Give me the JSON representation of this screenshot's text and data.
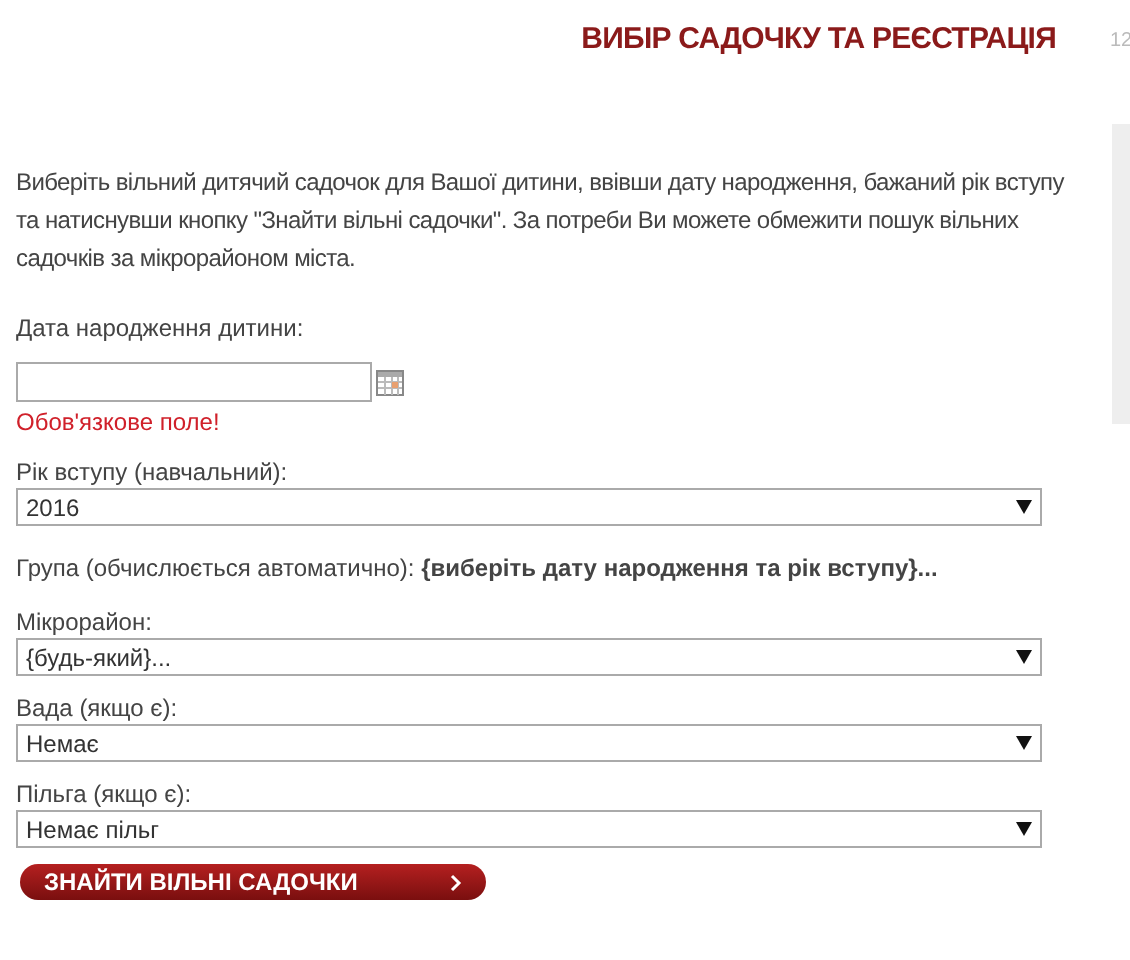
{
  "header": {
    "title": "ВИБІР САДОЧКУ ТА РЕЄСТРАЦІЯ",
    "side_text": "12"
  },
  "intro": "Виберіть вільний дитячий садочок для Вашої дитини, ввівши дату народження, бажаний рік вступу та натиснувши кнопку \"Знайти вільні садочки\". За потреби Ви можете обмежити пошук вільних садочків за мікрорайоном міста.",
  "birth_date": {
    "label": "Дата народження дитини:",
    "error": "Обов'язкове поле!"
  },
  "year": {
    "label": "Рік вступу (навчальний):",
    "value": "2016"
  },
  "group": {
    "text": "Група (обчислюється автоматично): **{виберіть дату народження та рік вступу}...**"
  },
  "selects": [
    {
      "label": "Мікрорайон:",
      "value": "{будь-який}..."
    },
    {
      "label": "Вада (якщо є):",
      "value": "Немає"
    },
    {
      "label": "Пільга (якщо є):",
      "value": "Немає пільг"
    }
  ],
  "submit": {
    "label": "ЗНАЙТИ ВІЛЬНІ САДОЧКИ"
  }
}
